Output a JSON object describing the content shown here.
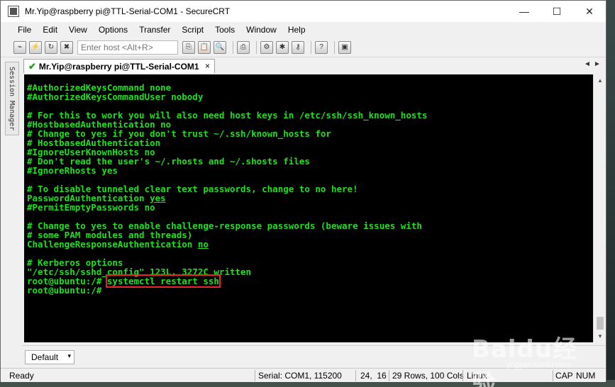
{
  "window": {
    "title": "Mr.Yip@raspberry pi@TTL-Serial-COM1 - SecureCRT",
    "controls": [
      "—",
      "☐",
      "✕"
    ]
  },
  "menu": [
    "File",
    "Edit",
    "View",
    "Options",
    "Transfer",
    "Script",
    "Tools",
    "Window",
    "Help"
  ],
  "toolbar": {
    "host_placeholder": "Enter host <Alt+R>",
    "icons_left": [
      "connect-icon",
      "quick-connect-icon",
      "reconnect-icon",
      "disconnect-icon"
    ],
    "icons_right": [
      "copy-icon",
      "paste-icon",
      "find-icon",
      "print-icon",
      "session-options-icon",
      "global-options-icon",
      "keymap-icon",
      "help-icon",
      "sftp-icon"
    ]
  },
  "side_panel": {
    "label": "Session Manager"
  },
  "session_tab": {
    "label": "Mr.Yip@raspberry pi@TTL-Serial-COM1",
    "close": "×",
    "prev": "◄",
    "next": "►"
  },
  "terminal": {
    "lines": [
      [
        {
          "t": "#AuthorizedKeysCommand none"
        }
      ],
      [
        {
          "t": "#AuthorizedKeysCommandUser nobody"
        }
      ],
      [
        {
          "t": ""
        }
      ],
      [
        {
          "t": "# For this to work you will also need host keys in /etc/ssh/ssh_known_hosts"
        }
      ],
      [
        {
          "t": "#HostbasedAuthentication no"
        }
      ],
      [
        {
          "t": "# Change to yes if you don't trust ~/.ssh/known_hosts for"
        }
      ],
      [
        {
          "t": "# HostbasedAuthentication"
        }
      ],
      [
        {
          "t": "#IgnoreUserKnownHosts no"
        }
      ],
      [
        {
          "t": "# Don't read the user's ~/.rhosts and ~/.shosts files"
        }
      ],
      [
        {
          "t": "#IgnoreRhosts yes"
        }
      ],
      [
        {
          "t": ""
        }
      ],
      [
        {
          "t": "# To disable tunneled clear text passwords, change to no here!"
        }
      ],
      [
        {
          "t": "PasswordAuthentication "
        },
        {
          "t": "yes",
          "u": true
        }
      ],
      [
        {
          "t": "#PermitEmptyPasswords no"
        }
      ],
      [
        {
          "t": ""
        }
      ],
      [
        {
          "t": "# Change to yes to enable challenge-response passwords (beware issues with"
        }
      ],
      [
        {
          "t": "# some PAM modules and threads)"
        }
      ],
      [
        {
          "t": "ChallengeResponseAuthentication "
        },
        {
          "t": "no",
          "u": true
        }
      ],
      [
        {
          "t": ""
        }
      ],
      [
        {
          "t": "# Kerberos options"
        }
      ],
      [
        {
          "t": "\"/etc/ssh/sshd_config\" 123L, 3272C written"
        }
      ],
      [
        {
          "t": "root@ubuntu:/# "
        },
        {
          "t": "systemctl restart ssh",
          "h": true
        }
      ],
      [
        {
          "t": "root@ubuntu:/# "
        }
      ]
    ]
  },
  "command_bar": {
    "default_label": "Default",
    "arrow": "▾"
  },
  "status": {
    "ready": "Ready",
    "serial": "Serial: COM1, 115200",
    "cursor": "24,  16",
    "size": "29 Rows, 100 Cols",
    "os": "Linux",
    "cap": "CAP",
    "num": "NUM"
  },
  "watermark": {
    "main": "Baidu经验",
    "sub": "jingyan.baidu.com"
  }
}
